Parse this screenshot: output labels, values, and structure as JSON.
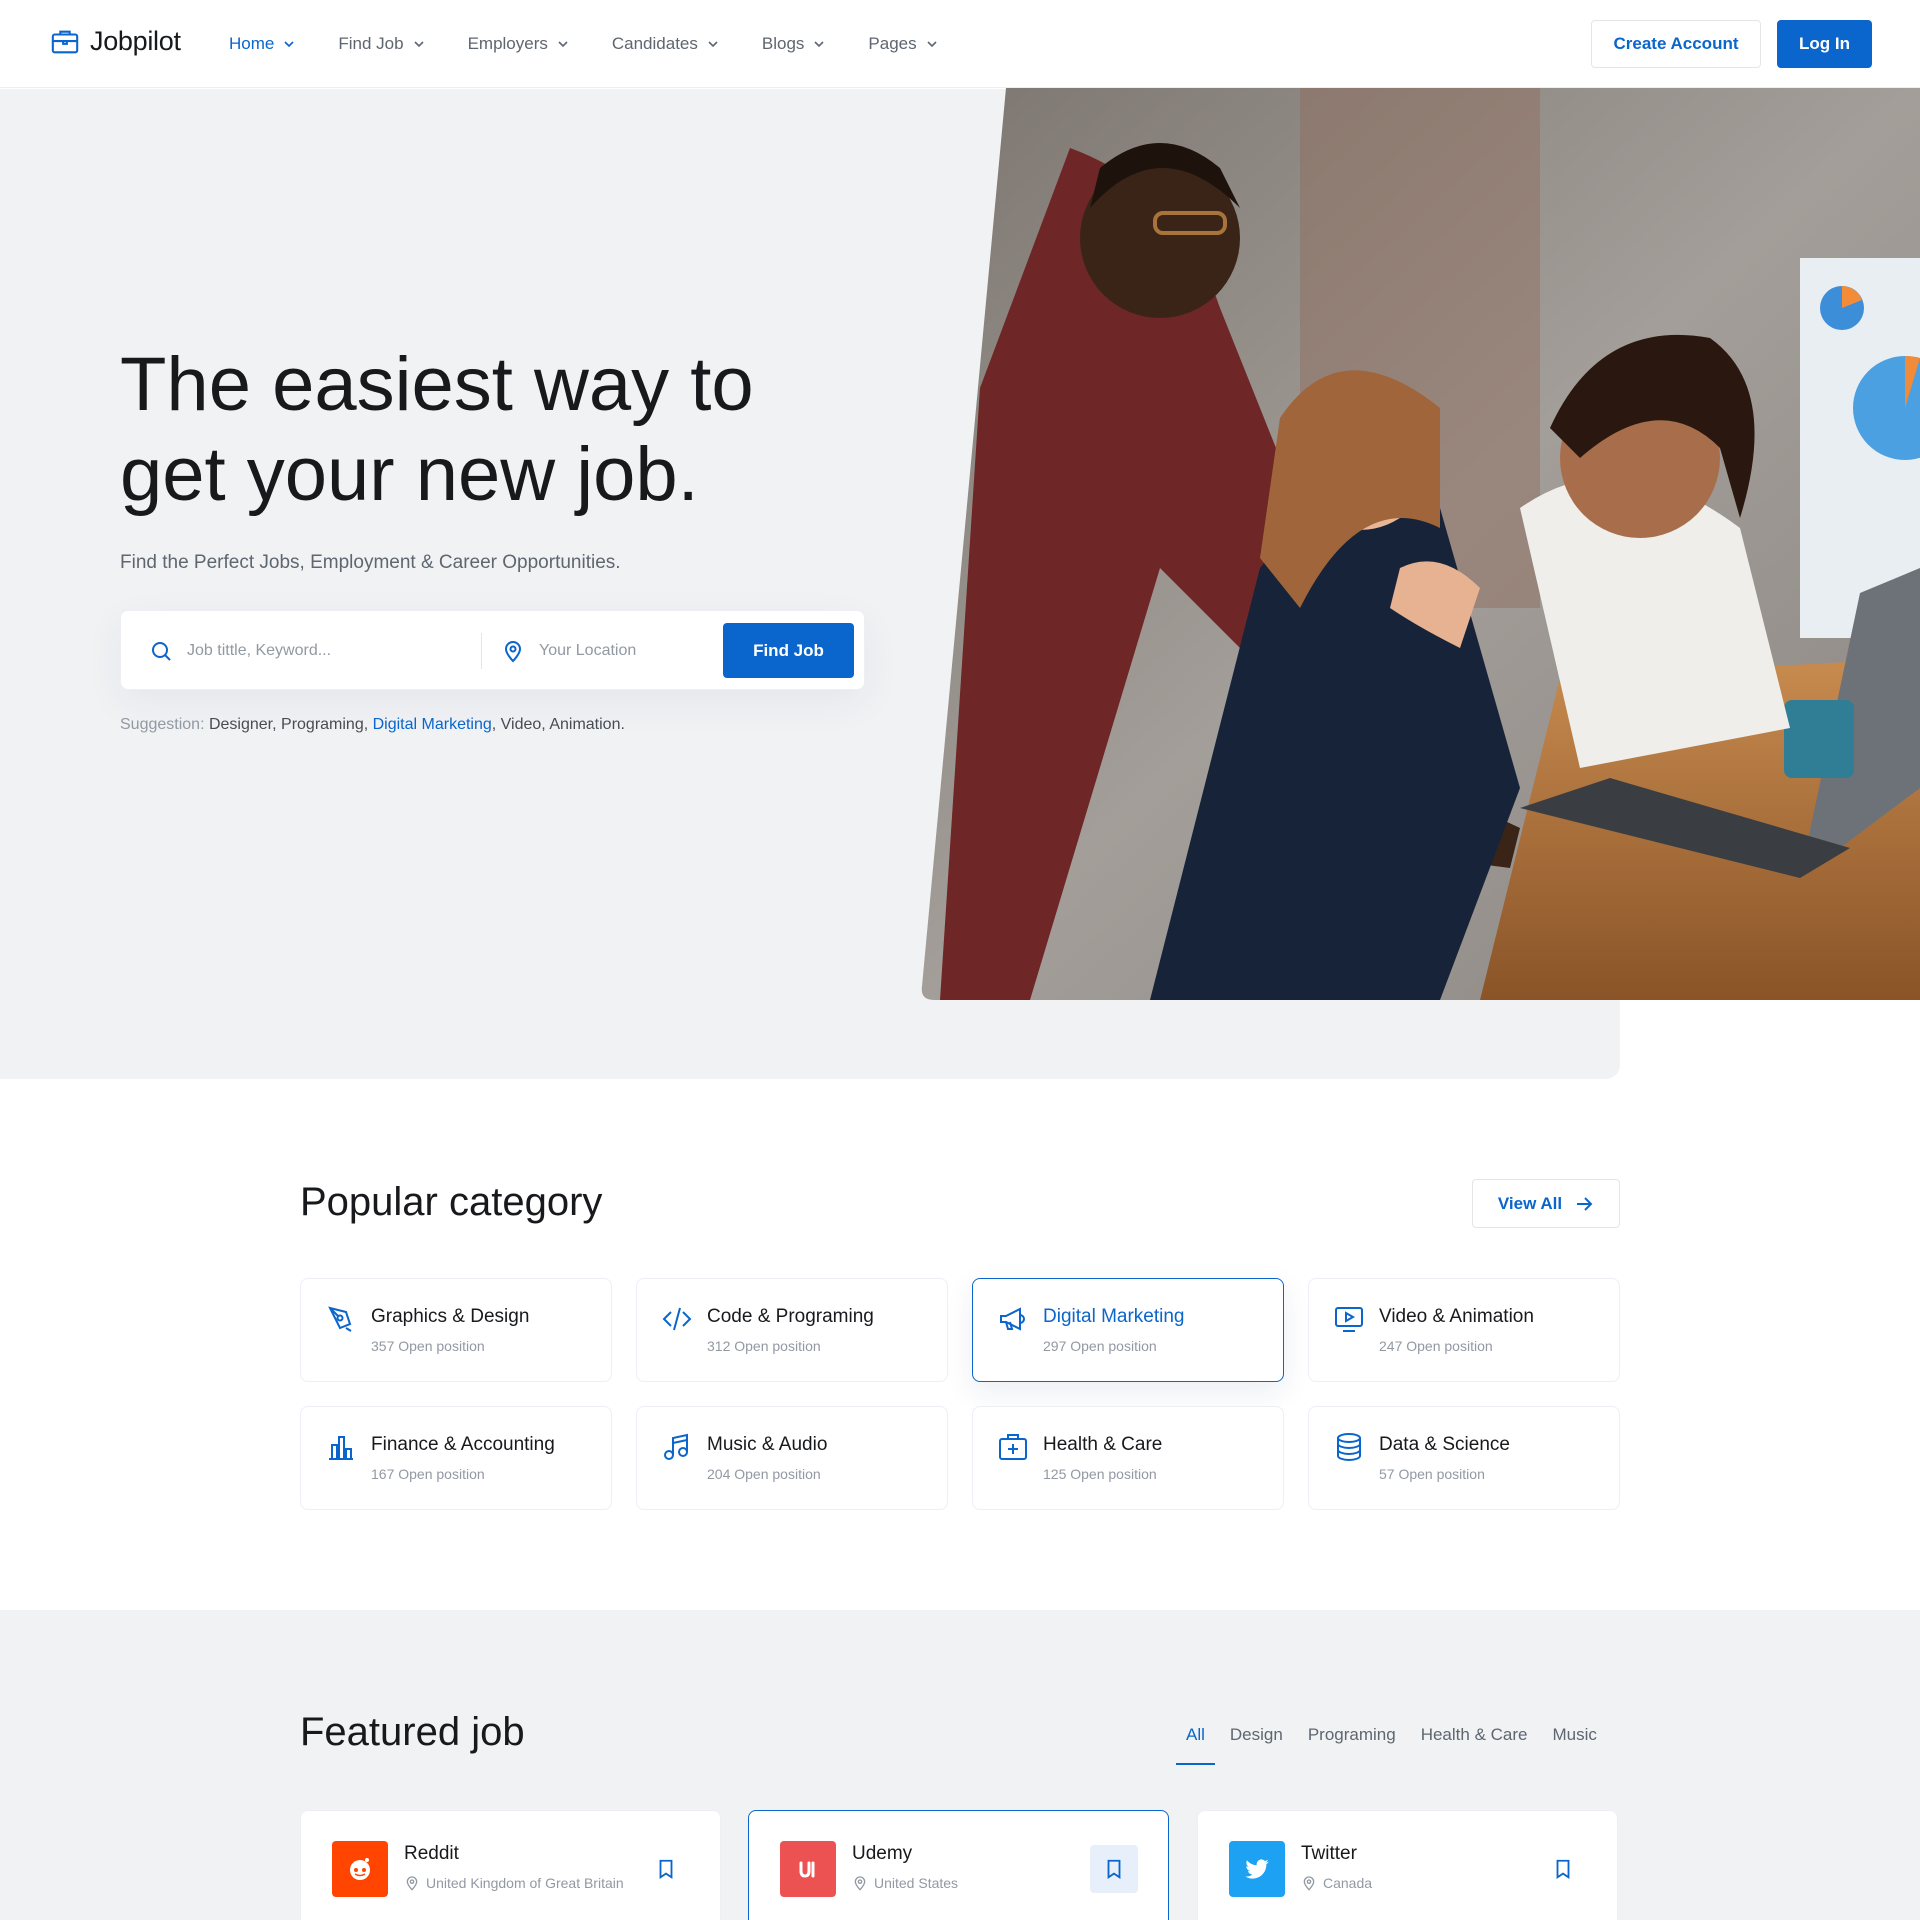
{
  "brand": {
    "name": "Jobpilot",
    "accent": "#0a65cc"
  },
  "nav": {
    "items": [
      {
        "label": "Home",
        "active": true
      },
      {
        "label": "Find Job",
        "active": false
      },
      {
        "label": "Employers",
        "active": false
      },
      {
        "label": "Candidates",
        "active": false
      },
      {
        "label": "Blogs",
        "active": false
      },
      {
        "label": "Pages",
        "active": false
      }
    ],
    "create_account": "Create Account",
    "login": "Log In"
  },
  "hero": {
    "title_line1": "The easiest way to",
    "title_line2": "get your new job.",
    "subtitle": "Find the Perfect Jobs, Employment & Career Opportunities.",
    "search": {
      "keyword_placeholder": "Job tittle, Keyword...",
      "location_placeholder": "Your Location",
      "button": "Find Job"
    },
    "suggestion_label": "Suggestion:",
    "suggestions": [
      {
        "label": "Designer",
        "sep": ", "
      },
      {
        "label": "Programing",
        "sep": ", "
      },
      {
        "label": "Digital Marketing",
        "sep": ", "
      },
      {
        "label": "Video",
        "sep": ", "
      },
      {
        "label": "Animation",
        "sep": "."
      }
    ],
    "highlighted_suggestion": "Digital Marketing"
  },
  "popular": {
    "title": "Popular category",
    "view_all": "View All",
    "categories": [
      {
        "name": "Graphics & Design",
        "count": "357 Open position",
        "icon": "pen-tool-icon"
      },
      {
        "name": "Code & Programing",
        "count": "312 Open position",
        "icon": "code-icon"
      },
      {
        "name": "Digital Marketing",
        "count": "297 Open position",
        "icon": "megaphone-icon",
        "active": true
      },
      {
        "name": "Video & Animation",
        "count": "247 Open position",
        "icon": "video-icon"
      },
      {
        "name": "Finance & Accounting",
        "count": "167 Open position",
        "icon": "bar-chart-icon"
      },
      {
        "name": "Music & Audio",
        "count": "204 Open position",
        "icon": "music-icon"
      },
      {
        "name": "Health & Care",
        "count": "125 Open position",
        "icon": "first-aid-icon"
      },
      {
        "name": "Data & Science",
        "count": "57 Open position",
        "icon": "database-icon"
      }
    ]
  },
  "featured": {
    "title": "Featured job",
    "tabs": [
      "All",
      "Design",
      "Programing",
      "Health & Care",
      "Music"
    ],
    "active_tab": "All",
    "jobs": [
      {
        "company": "Reddit",
        "location": "United Kingdom of Great Britain",
        "logo_color": "#ff4500",
        "icon": "reddit-icon"
      },
      {
        "company": "Udemy",
        "location": "United States",
        "logo_color": "#ec5252",
        "icon": "udemy-icon",
        "active": true
      },
      {
        "company": "Twitter",
        "location": "Canada",
        "logo_color": "#1da1f2",
        "icon": "twitter-icon"
      }
    ]
  }
}
